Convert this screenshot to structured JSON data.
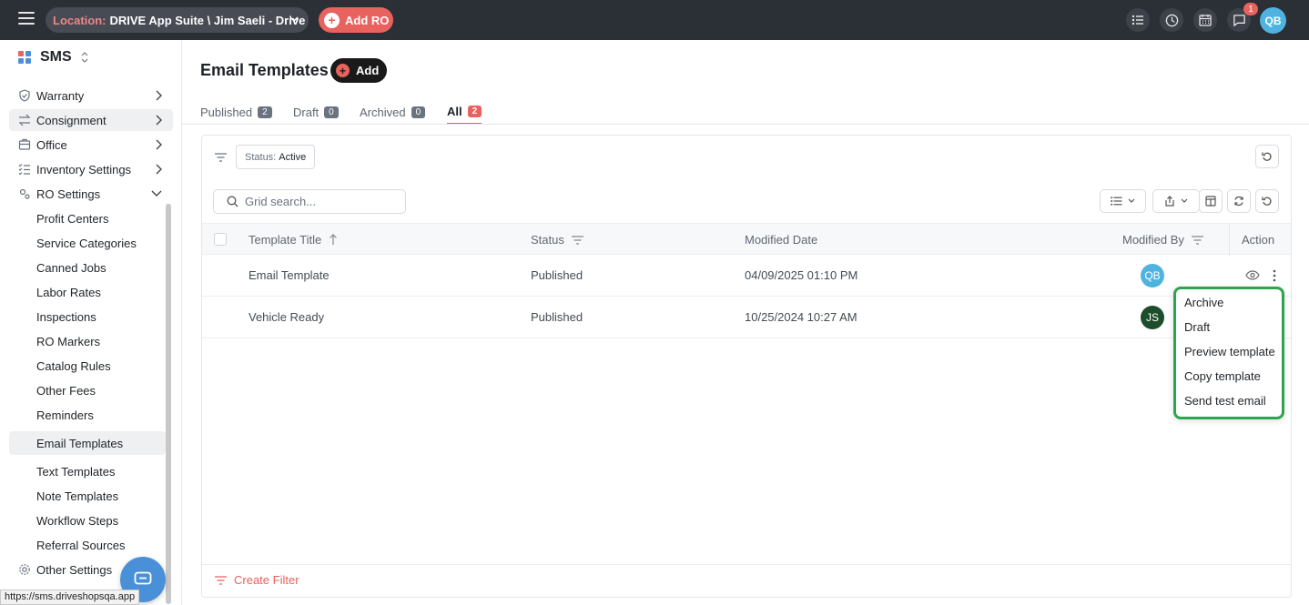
{
  "topbar": {
    "location_label": "Location:",
    "location_value": "DRIVE App Suite \\ Jim Saeli - Drive",
    "add_ro_label": "Add RO",
    "notification_count": "1",
    "user_initials": "QB"
  },
  "sidebar": {
    "brand": "SMS",
    "nav": [
      {
        "label": "Warranty",
        "icon": "shield-icon"
      },
      {
        "label": "Consignment",
        "icon": "swap-icon"
      },
      {
        "label": "Office",
        "icon": "building-icon"
      },
      {
        "label": "Inventory Settings",
        "icon": "list-check-icon"
      },
      {
        "label": "RO Settings",
        "icon": "settings-icon"
      }
    ],
    "sub_items": [
      "Profit Centers",
      "Service Categories",
      "Canned Jobs",
      "Labor Rates",
      "Inspections",
      "RO Markers",
      "Catalog Rules",
      "Other Fees",
      "Reminders",
      "Email Templates",
      "Text Templates",
      "Note Templates",
      "Workflow Steps",
      "Referral Sources"
    ],
    "other_settings": "Other Settings",
    "status_url": "https://sms.driveshopsqa.app"
  },
  "main": {
    "title": "Email Templates",
    "add_label": "Add",
    "tabs": [
      {
        "label": "Published",
        "count": "2"
      },
      {
        "label": "Draft",
        "count": "0"
      },
      {
        "label": "Archived",
        "count": "0"
      },
      {
        "label": "All",
        "count": "2"
      }
    ],
    "filter": {
      "status_key": "Status:",
      "status_value": "Active"
    },
    "search_placeholder": "Grid search...",
    "columns": [
      "Template Title",
      "Status",
      "Modified Date",
      "Modified By",
      "Action"
    ],
    "rows": [
      {
        "title": "Email Template",
        "status": "Published",
        "date": "04/09/2025 01:10 PM",
        "by": "QB",
        "by_color": "#4fb3e0"
      },
      {
        "title": "Vehicle Ready",
        "status": "Published",
        "date": "10/25/2024 10:27 AM",
        "by": "JS",
        "by_color": "#1e4d2b"
      }
    ],
    "create_filter": "Create Filter"
  },
  "action_menu": [
    "Archive",
    "Draft",
    "Preview template",
    "Copy template",
    "Send test email"
  ],
  "colors": {
    "accent": "#e8625e",
    "topbar": "#2b2f36",
    "menu_border": "#2ea44f"
  }
}
